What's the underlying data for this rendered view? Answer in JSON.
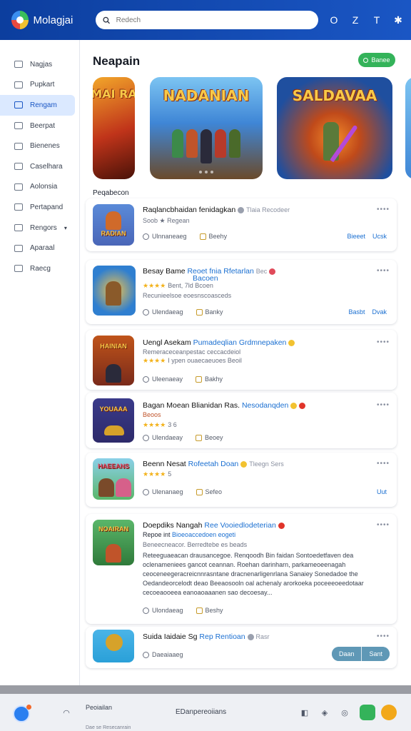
{
  "app": {
    "title": "Molagjai"
  },
  "search": {
    "placeholder": "Redech"
  },
  "topbar": {
    "icons": [
      "account-icon",
      "edit-icon",
      "text-icon",
      "settings-icon"
    ],
    "glyphs": [
      "O",
      "Z",
      "T",
      "✱"
    ]
  },
  "sidebar": {
    "items": [
      {
        "label": "Nagjas",
        "icon": "folder-icon"
      },
      {
        "label": "Pupkart",
        "icon": "tag-icon"
      },
      {
        "label": "Rengam",
        "icon": "grid-icon",
        "active": true
      },
      {
        "label": "Beerpat",
        "icon": "library-icon"
      },
      {
        "label": "Bienenes",
        "icon": "box-icon"
      },
      {
        "label": "Caselhara",
        "icon": "cloud-icon"
      },
      {
        "label": "Aolonsia",
        "icon": "list-icon"
      },
      {
        "label": "Pertapand",
        "icon": "calendar-icon"
      },
      {
        "label": "Rengors",
        "icon": "filter-icon",
        "caret": "▾"
      },
      {
        "label": "Aparaal",
        "icon": "location-icon"
      },
      {
        "label": "Raecg",
        "icon": "document-icon"
      }
    ]
  },
  "main": {
    "title": "Neapain",
    "action_label": "Banee",
    "banners": [
      {
        "title": "MAI RA",
        "bg": "#c0341a"
      },
      {
        "title": "NADANIAN",
        "bg": "#3f86d6"
      },
      {
        "title": "SALDAVAA",
        "bg": "#1f4f9f"
      }
    ],
    "section_label": "Peqabecon"
  },
  "cards": [
    {
      "title": "Raqlancbhaidan fenidagkan",
      "title_suffix": "Tlaia Recodeer",
      "sub": "Soob ★ Regean",
      "meta1": "Ulnnaneaeg",
      "meta2": "Beehy",
      "actions": [
        "Bieeet",
        "Ucsk"
      ],
      "thumb_title": "RADIAN",
      "thumb_bg": "#4a66b8"
    },
    {
      "title": "Besay Bame",
      "title_hl": "Reoet fnia Rfetarlan",
      "title_hl2": "Bacoen",
      "title_suffix": "Bec",
      "stars": "★★★★",
      "stars_note": "Bent, 7ld Bcoen",
      "sub": "Recunieelsoe eoesnscoasceds",
      "meta1": "Ulendaeag",
      "meta2": "Banky",
      "actions": [
        "Basbt",
        "Dvak"
      ],
      "thumb_title": "",
      "thumb_bg": "#2f7fd0"
    },
    {
      "title": "Uengl Asekam",
      "title_hl": "Pumadeqlian Grdmnepaken",
      "sub": "Remeraceceanpestac ceccacdeiol",
      "stars": "★★★★",
      "stars_note": "I ypen ouaecaeuoes Beoil",
      "meta1": "Uleenaeay",
      "meta2": "Bakhy",
      "actions": [],
      "thumb_title": "HAINIAN",
      "thumb_bg": "#7a2a1a"
    },
    {
      "title": "Bagan Moean Blianidan Ras.",
      "title_hl": "Nesodanqden",
      "sub": "Beoos",
      "stars": "★★★★",
      "stars_note": "3 6",
      "meta1": "Ulendaeay",
      "meta2": "Beoey",
      "actions": [],
      "thumb_title": "YOUAAA",
      "thumb_bg": "#2d2a6a"
    },
    {
      "title": "Beenn Nesat",
      "title_hl": "Rofeetah Doan",
      "title_suffix": "Tleegn Sers",
      "stars": "★★★★",
      "stars_note": "5",
      "meta1": "Ulenanaeg",
      "meta2": "Sefeo",
      "actions": [
        "Uut"
      ],
      "thumb_title": "HAEEANS",
      "thumb_bg": "#5ab66a"
    },
    {
      "title": "Doepdiks Nangah",
      "title_hl": "Ree Vooiedlodeterian",
      "sub": "Repoe int",
      "sub_hl": "Bioeoaccedoen eogeti",
      "sub2": "Beneecneacor. Berredtebe es beads",
      "desc": "Reteeguaeacan drausancegoe. Renqoodh Bin faidan Sontoedetfaven dea oclenameniees gancot ceannan. Roehan darinharn, parkameoeenagah ceoceneegeracreicnnrasntane dracnenarligenrlana Sanaiey Sonedadoe the Oedandeorcelodt deao Beeaosooln oal achenaly arorkoeka poceeeoeedotaar cecoeaooeea eanoaoaaanen sao decoesay...",
      "meta1": "Ulondaeag",
      "meta2": "Beshy",
      "actions": [],
      "thumb_title": "NOAIRAN",
      "thumb_bg": "#2f7a3a"
    },
    {
      "title": "Suida Iaidaie Sg",
      "title_hl": "Rep Rentioan",
      "title_suffix": "Rasr",
      "meta1": "Daeaiaaeg",
      "actions": [],
      "btns": [
        "Daan",
        "Sant"
      ],
      "thumb_title": "",
      "thumb_bg": "#2aa0d8"
    }
  ],
  "bottombar": {
    "left_top": "Peoiailan",
    "left_bottom": "Dae se Resecanrain",
    "center": "EDanpereoiians"
  }
}
